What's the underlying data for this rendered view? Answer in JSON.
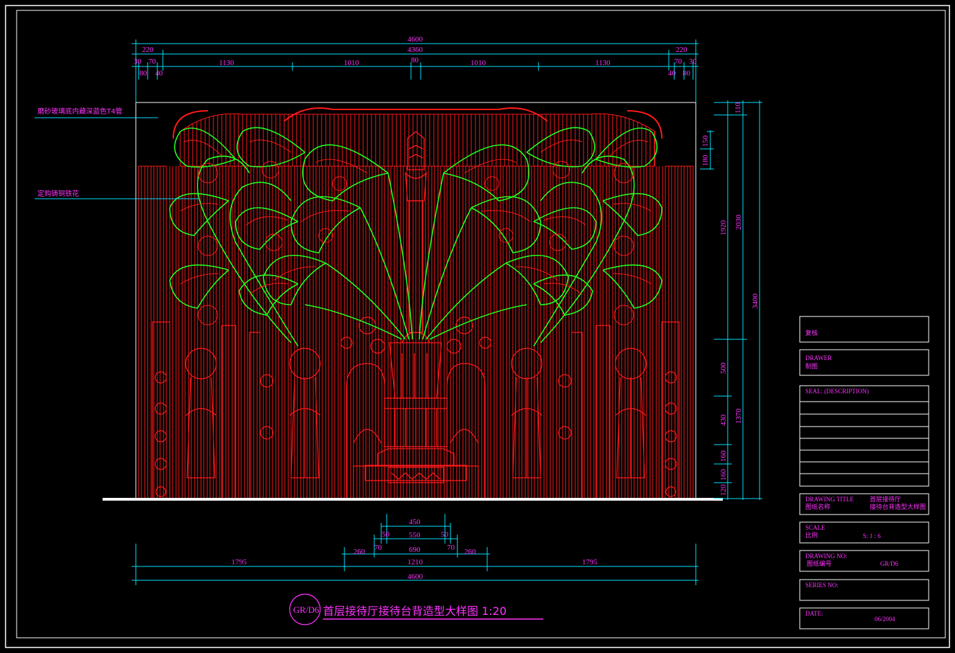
{
  "drawing": {
    "title_code": "GR/D6",
    "title_text": "首层接待厅接待台背造型大样图 1:20"
  },
  "callouts": [
    {
      "text": "磨砂玻璃底内藏深蓝色T4管"
    },
    {
      "text": "定购铸铜铁花"
    }
  ],
  "top_dims": {
    "overall": "4600",
    "inner": "4360",
    "side_left": "220",
    "side_right": "220",
    "small_left": [
      "30",
      "70",
      "80",
      "40"
    ],
    "small_right": [
      "70",
      "30",
      "40",
      "80"
    ],
    "spans": [
      "1130",
      "1010",
      "80",
      "1010",
      "1130"
    ]
  },
  "bottom_dims": {
    "row1": [
      "450"
    ],
    "row2": [
      "50",
      "550",
      "50"
    ],
    "row3": [
      "70",
      "690",
      "70"
    ],
    "row3_side": [
      "260",
      "260"
    ],
    "row4": [
      "1795",
      "1210",
      "1795"
    ],
    "overall": "4600"
  },
  "right_dims": {
    "col1": [
      "110",
      "150",
      "180",
      "1920",
      "500",
      "430",
      "160",
      "160",
      "120"
    ],
    "col2": [
      "2030",
      "1370"
    ],
    "col3": [
      "3400"
    ]
  },
  "title_block": {
    "check_label": "复核",
    "drawer_label": "DRAWER",
    "drawer_cn": "制图",
    "seal_label": "SEAL: (DESCRIPTION)",
    "drawing_title_label": "DRAWING  TITLE",
    "drawing_title_cn": "图纸名称",
    "drawing_title_value_1": "首层接待厅",
    "drawing_title_value_2": "接待台背造型大样图",
    "scale_label": "SCALE",
    "scale_cn": "比例",
    "scale_value": "S:   1 : 6",
    "drawing_no_label": "DRAWING        NO:",
    "drawing_no_cn": "图纸编号",
    "drawing_no_value": "GR/D6",
    "series_label": "SERIES  NO:",
    "date_label": "DATE:",
    "date_value": "06/2004"
  },
  "colors": {
    "background": "#000000",
    "frame": "#ffffff",
    "ornament_red": "#ff1a1a",
    "ornament_green": "#22ff22",
    "dimension_cyan": "#00e5ff",
    "text_magenta": "#ff33ff"
  }
}
